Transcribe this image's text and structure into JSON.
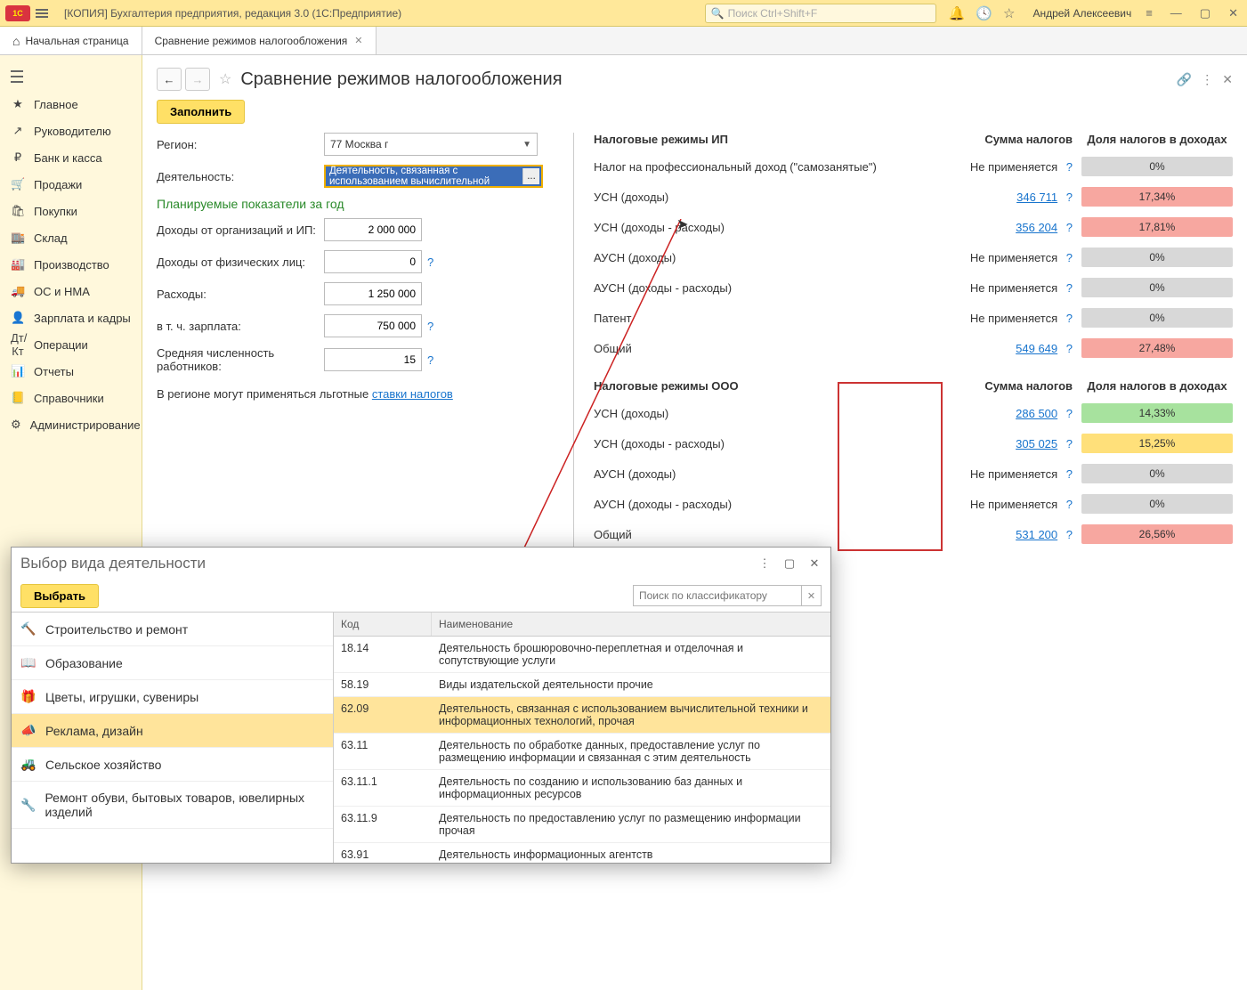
{
  "titlebar": {
    "logo": "1C",
    "app_title": "[КОПИЯ] Бухгалтерия предприятия, редакция 3.0  (1С:Предприятие)",
    "search_placeholder": "Поиск Ctrl+Shift+F",
    "user": "Андрей Алексеевич"
  },
  "tabs": {
    "home": "Начальная страница",
    "active": "Сравнение режимов налогообложения"
  },
  "sidebar": [
    {
      "icon": "★",
      "label": "Главное"
    },
    {
      "icon": "↗",
      "label": "Руководителю"
    },
    {
      "icon": "₽",
      "label": "Банк и касса"
    },
    {
      "icon": "🛒",
      "label": "Продажи"
    },
    {
      "icon": "🛍",
      "label": "Покупки"
    },
    {
      "icon": "🏬",
      "label": "Склад"
    },
    {
      "icon": "🏭",
      "label": "Производство"
    },
    {
      "icon": "🚚",
      "label": "ОС и НМА"
    },
    {
      "icon": "👤",
      "label": "Зарплата и кадры"
    },
    {
      "icon": "Дт/Кт",
      "label": "Операции"
    },
    {
      "icon": "📊",
      "label": "Отчеты"
    },
    {
      "icon": "📒",
      "label": "Справочники"
    },
    {
      "icon": "⚙",
      "label": "Администрирование"
    }
  ],
  "page_title": "Сравнение режимов налогообложения",
  "fill_btn": "Заполнить",
  "form": {
    "region_label": "Регион:",
    "region_value": "77 Москва г",
    "activity_label": "Деятельность:",
    "activity_value": "Деятельность, связанная с использованием вычислительной",
    "planned_header": "Планируемые показатели за год",
    "income_org_label": "Доходы от организаций и ИП:",
    "income_org_value": "2 000 000",
    "income_phys_label": "Доходы от физических лиц:",
    "income_phys_value": "0",
    "expenses_label": "Расходы:",
    "expenses_value": "1 250 000",
    "salary_label": "в т. ч. зарплата:",
    "salary_value": "750 000",
    "headcount_label": "Средняя численность работников:",
    "headcount_value": "15",
    "footnote_prefix": "В регионе могут применяться льготные ",
    "footnote_link": "ставки налогов"
  },
  "tax_ip_header": "Налоговые режимы ИП",
  "tax_ooo_header": "Налоговые режимы ООО",
  "sum_header": "Сумма налогов",
  "share_header": "Доля налогов в доходах",
  "na_text": "Не применяется",
  "help_q": "?",
  "ip_rows": [
    {
      "name": "Налог на профессиональный доход (\"самозанятые\")",
      "sum": null,
      "share": "0%",
      "share_cls": "share-grey"
    },
    {
      "name": "УСН (доходы)",
      "sum": "346 711",
      "share": "17,34%",
      "share_cls": "share-red"
    },
    {
      "name": "УСН (доходы - расходы)",
      "sum": "356 204",
      "share": "17,81%",
      "share_cls": "share-red"
    },
    {
      "name": "АУСН (доходы)",
      "sum": null,
      "share": "0%",
      "share_cls": "share-grey"
    },
    {
      "name": "АУСН (доходы - расходы)",
      "sum": null,
      "share": "0%",
      "share_cls": "share-grey"
    },
    {
      "name": "Патент",
      "sum": null,
      "share": "0%",
      "share_cls": "share-grey"
    },
    {
      "name": "Общий",
      "sum": "549 649",
      "share": "27,48%",
      "share_cls": "share-red"
    }
  ],
  "ooo_rows": [
    {
      "name": "УСН (доходы)",
      "sum": "286 500",
      "share": "14,33%",
      "share_cls": "share-green"
    },
    {
      "name": "УСН (доходы - расходы)",
      "sum": "305 025",
      "share": "15,25%",
      "share_cls": "share-yellow"
    },
    {
      "name": "АУСН (доходы)",
      "sum": null,
      "share": "0%",
      "share_cls": "share-grey"
    },
    {
      "name": "АУСН (доходы - расходы)",
      "sum": null,
      "share": "0%",
      "share_cls": "share-grey"
    },
    {
      "name": "Общий",
      "sum": "531 200",
      "share": "26,56%",
      "share_cls": "share-red"
    }
  ],
  "modal": {
    "title": "Выбор вида деятельности",
    "select_btn": "Выбрать",
    "search_placeholder": "Поиск по классификатору",
    "categories": [
      {
        "icon": "🔨",
        "label": "Строительство и ремонт",
        "sel": false
      },
      {
        "icon": "📖",
        "label": "Образование",
        "sel": false
      },
      {
        "icon": "🎁",
        "label": "Цветы, игрушки, сувениры",
        "sel": false
      },
      {
        "icon": "📣",
        "label": "Реклама, дизайн",
        "sel": true
      },
      {
        "icon": "🚜",
        "label": "Сельское хозяйство",
        "sel": false
      },
      {
        "icon": "🔧",
        "label": "Ремонт обуви, бытовых товаров, ювелирных изделий",
        "sel": false
      }
    ],
    "table_headers": {
      "code": "Код",
      "name": "Наименование"
    },
    "rows": [
      {
        "code": "18.14",
        "name": "Деятельность брошюровочно-переплетная и отделочная и сопутствующие услуги",
        "sel": false
      },
      {
        "code": "58.19",
        "name": "Виды издательской деятельности прочие",
        "sel": false
      },
      {
        "code": "62.09",
        "name": "Деятельность, связанная с использованием вычислительной техники и информационных технологий, прочая",
        "sel": true
      },
      {
        "code": "63.11",
        "name": "Деятельность по обработке данных, предоставление услуг по размещению информации и связанная с этим деятельность",
        "sel": false
      },
      {
        "code": "63.11.1",
        "name": "Деятельность по созданию и использованию баз данных и информационных ресурсов",
        "sel": false
      },
      {
        "code": "63.11.9",
        "name": "Деятельность по предоставлению услуг по размещению информации прочая",
        "sel": false
      },
      {
        "code": "63.91",
        "name": "Деятельность информационных агентств",
        "sel": false
      }
    ]
  }
}
